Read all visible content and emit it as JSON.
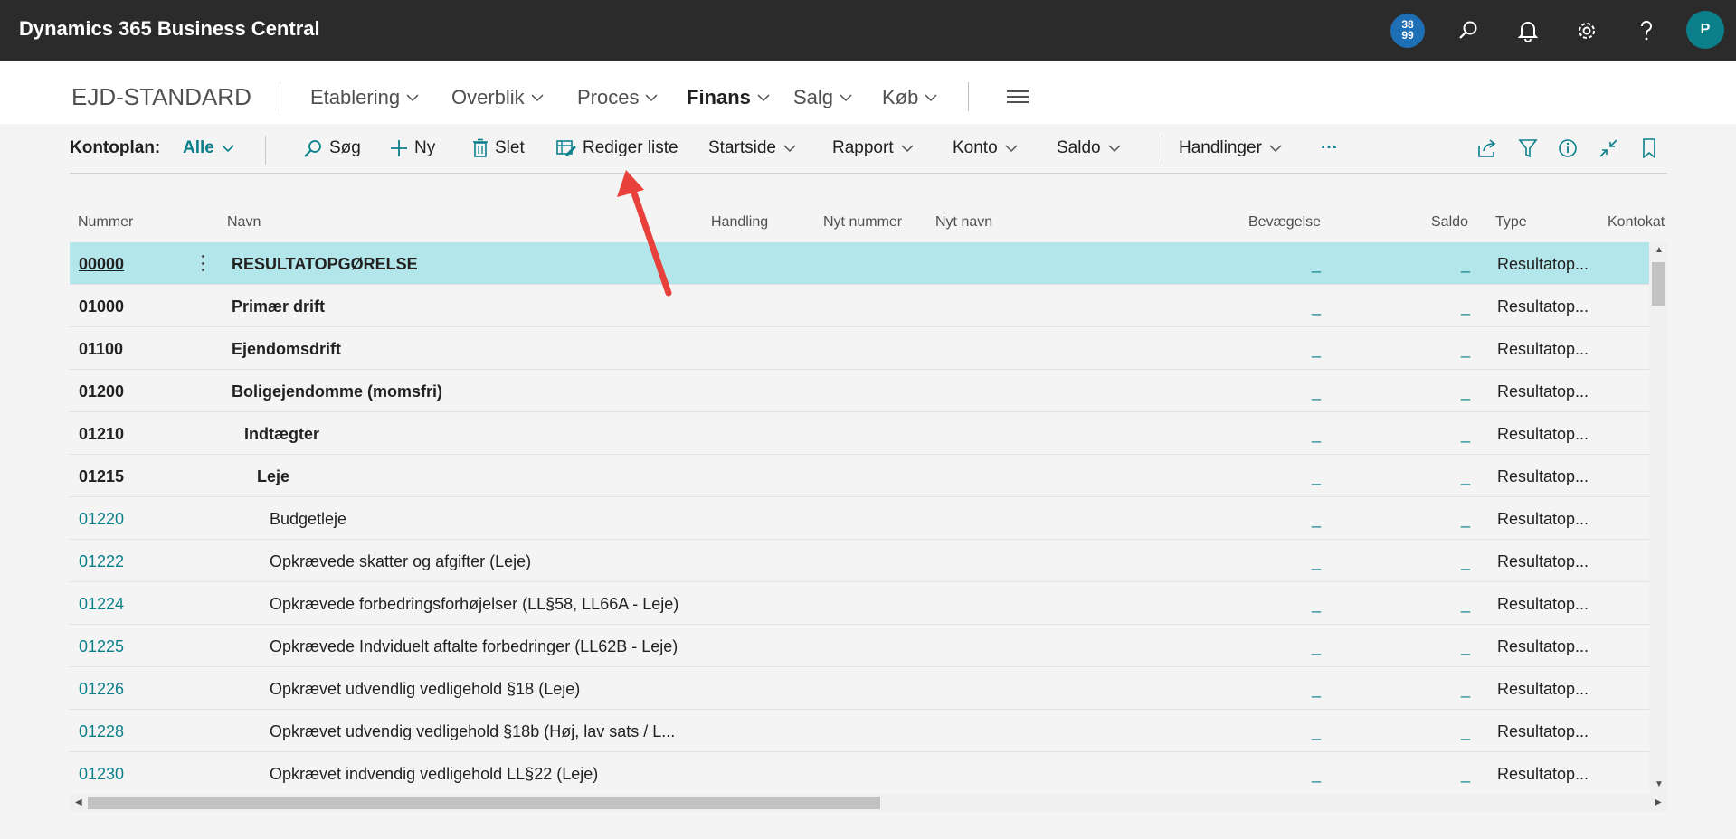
{
  "topbar": {
    "app_title": "Dynamics 365 Business Central",
    "notification_badge_line1": "38",
    "notification_badge_line2": "99",
    "avatar_initial": "P"
  },
  "nav": {
    "company": "EJD-STANDARD",
    "items": [
      {
        "label": "Etablering",
        "active": false
      },
      {
        "label": "Overblik",
        "active": false
      },
      {
        "label": "Proces",
        "active": false
      },
      {
        "label": "Finans",
        "active": true
      },
      {
        "label": "Salg",
        "active": false
      },
      {
        "label": "Køb",
        "active": false
      }
    ]
  },
  "actionbar": {
    "filter_label": "Kontoplan:",
    "filter_value": "Alle",
    "search": "Søg",
    "new": "Ny",
    "delete": "Slet",
    "edit_list": "Rediger liste",
    "startside": "Startside",
    "rapport": "Rapport",
    "konto": "Konto",
    "saldo": "Saldo",
    "handlinger": "Handlinger",
    "more": "···"
  },
  "grid": {
    "columns": [
      "Nummer",
      "Navn",
      "Handling",
      "Nyt nummer",
      "Nyt navn",
      "Bevægelse",
      "Saldo",
      "Type",
      "Kontokat"
    ],
    "rows": [
      {
        "number": "00000",
        "name": "RESULTATOPGØRELSE",
        "indent": 0,
        "style": "selected",
        "bevaegelse": "_",
        "saldo": "_",
        "type": "Resultatop..."
      },
      {
        "number": "01000",
        "name": "Primær drift",
        "indent": 0,
        "style": "bold",
        "bevaegelse": "_",
        "saldo": "_",
        "type": "Resultatop..."
      },
      {
        "number": "01100",
        "name": "Ejendomsdrift",
        "indent": 0,
        "style": "bold",
        "bevaegelse": "_",
        "saldo": "_",
        "type": "Resultatop..."
      },
      {
        "number": "01200",
        "name": "Boligejendomme (momsfri)",
        "indent": 0,
        "style": "bold",
        "bevaegelse": "_",
        "saldo": "_",
        "type": "Resultatop..."
      },
      {
        "number": "01210",
        "name": "Indtægter",
        "indent": 1,
        "style": "bold",
        "bevaegelse": "_",
        "saldo": "_",
        "type": "Resultatop..."
      },
      {
        "number": "01215",
        "name": "Leje",
        "indent": 2,
        "style": "bold",
        "bevaegelse": "_",
        "saldo": "_",
        "type": "Resultatop..."
      },
      {
        "number": "01220",
        "name": "Budgetleje",
        "indent": 3,
        "style": "link",
        "bevaegelse": "_",
        "saldo": "_",
        "type": "Resultatop..."
      },
      {
        "number": "01222",
        "name": "Opkrævede skatter og afgifter (Leje)",
        "indent": 3,
        "style": "link",
        "bevaegelse": "_",
        "saldo": "_",
        "type": "Resultatop..."
      },
      {
        "number": "01224",
        "name": "Opkrævede forbedringsforhøjelser (LL§58, LL66A - Leje)",
        "indent": 3,
        "style": "link",
        "bevaegelse": "_",
        "saldo": "_",
        "type": "Resultatop..."
      },
      {
        "number": "01225",
        "name": "Opkrævede Indviduelt aftalte forbedringer (LL62B - Leje)",
        "indent": 3,
        "style": "link",
        "bevaegelse": "_",
        "saldo": "_",
        "type": "Resultatop..."
      },
      {
        "number": "01226",
        "name": "Opkrævet udvendlig vedligehold §18 (Leje)",
        "indent": 3,
        "style": "link",
        "bevaegelse": "_",
        "saldo": "_",
        "type": "Resultatop..."
      },
      {
        "number": "01228",
        "name": "Opkrævet udvendig vedligehold §18b (Høj, lav sats / L...",
        "indent": 3,
        "style": "link",
        "bevaegelse": "_",
        "saldo": "_",
        "type": "Resultatop..."
      },
      {
        "number": "01230",
        "name": "Opkrævet indvendig vedligehold LL§22 (Leje)",
        "indent": 3,
        "style": "link",
        "bevaegelse": "_",
        "saldo": "_",
        "type": "Resultatop..."
      }
    ]
  },
  "colors": {
    "topbar": "#2b2b2b",
    "accent": "#0b7f8a",
    "selected_row": "#b2e6ea",
    "annotation_arrow": "#e8403a"
  }
}
